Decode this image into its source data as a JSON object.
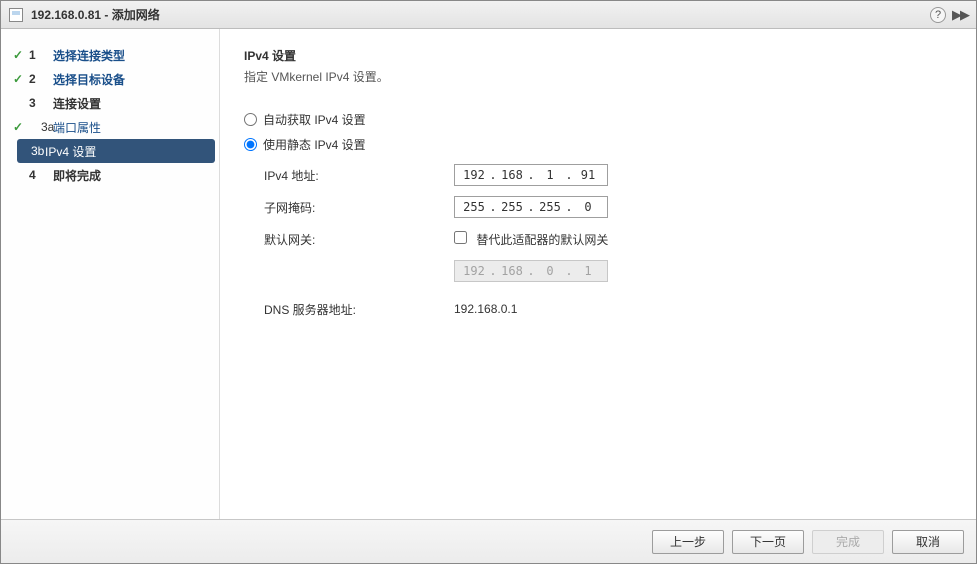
{
  "titlebar": {
    "title": "192.168.0.81 - 添加网络",
    "help": "?"
  },
  "sidebar": {
    "steps": [
      {
        "num": "1",
        "label": "选择连接类型",
        "checked": true
      },
      {
        "num": "2",
        "label": "选择目标设备",
        "checked": true
      },
      {
        "num": "3",
        "label": "连接设置",
        "checked": false
      },
      {
        "num": "3a",
        "label": "端口属性",
        "checked": true,
        "sub": true
      },
      {
        "num": "3b",
        "label": "IPv4 设置",
        "checked": false,
        "sub": true,
        "active": true
      },
      {
        "num": "4",
        "label": "即将完成",
        "checked": false
      }
    ]
  },
  "content": {
    "section_title": "IPv4 设置",
    "section_desc": "指定 VMkernel IPv4 设置。",
    "radio_auto": "自动获取 IPv4 设置",
    "radio_static": "使用静态 IPv4 设置",
    "ipv4_addr_label": "IPv4 地址:",
    "ipv4_addr": {
      "o1": "192",
      "o2": "168",
      "o3": "1",
      "o4": "91"
    },
    "subnet_label": "子网掩码:",
    "subnet": {
      "o1": "255",
      "o2": "255",
      "o3": "255",
      "o4": "0"
    },
    "gateway_label": "默认网关:",
    "gateway_checkbox": "替代此适配器的默认网关",
    "gateway": {
      "o1": "192",
      "o2": "168",
      "o3": "0",
      "o4": "1"
    },
    "dns_label": "DNS 服务器地址:",
    "dns_value": "192.168.0.1"
  },
  "footer": {
    "back": "上一步",
    "next": "下一页",
    "finish": "完成",
    "cancel": "取消"
  }
}
